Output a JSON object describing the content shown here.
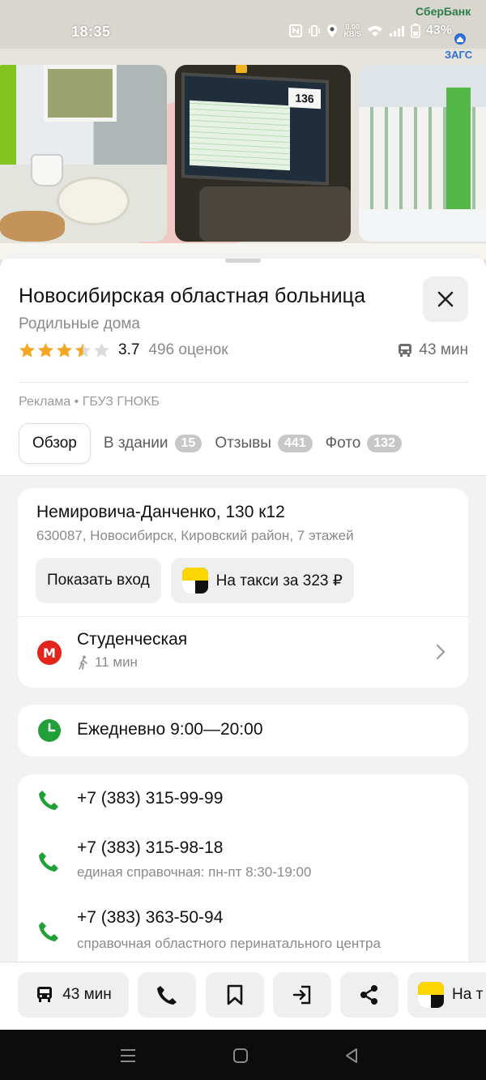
{
  "status_bar": {
    "time": "18:35",
    "network_speed_top": "0.00",
    "network_speed_bottom": "KB/S",
    "battery": "43%"
  },
  "map": {
    "poi_bank": "СберБанк",
    "poi_zags": "ЗАГС"
  },
  "photos": {
    "monitor_reading": "136"
  },
  "place": {
    "name": "Новосибирская областная больница",
    "category": "Родильные дома",
    "rating": 3.7,
    "rating_text": "3.7",
    "stars_filled": 3.5,
    "reviews_count": "496 оценок",
    "route_time": "43 мин",
    "ad_label": "Реклама",
    "advertiser": "ГБУЗ ГНОКБ"
  },
  "tabs": [
    {
      "label": "Обзор",
      "badge": null,
      "active": true
    },
    {
      "label": "В здании",
      "badge": "15",
      "active": false
    },
    {
      "label": "Отзывы",
      "badge": "441",
      "active": false
    },
    {
      "label": "Фото",
      "badge": "132",
      "active": false
    }
  ],
  "address": {
    "street": "Немировича-Данченко, 130 к12",
    "details": "630087, Новосибирск, Кировский район, 7 этажей",
    "show_entrance": "Показать вход",
    "taxi": "На такси за 323 ₽",
    "metro_letter": "М",
    "metro_station": "Студенческая",
    "metro_walk": "11 мин"
  },
  "hours": {
    "text": "Ежедневно 9:00—20:00"
  },
  "phones": [
    {
      "number": "+7 (383) 315-99-99",
      "note": ""
    },
    {
      "number": "+7 (383) 315-98-18",
      "note": "единая справочная: пн-пт 8:30-19:00"
    },
    {
      "number": "+7 (383) 363-50-94",
      "note": "справочная областного перинатального центра"
    }
  ],
  "actions": {
    "route_label": "43 мин",
    "taxi_label": "На т"
  },
  "colors": {
    "accent_green": "#21a038",
    "metro_red": "#e3241a",
    "star_gold": "#f5a623",
    "taxi_yellow": "#fcd600"
  }
}
